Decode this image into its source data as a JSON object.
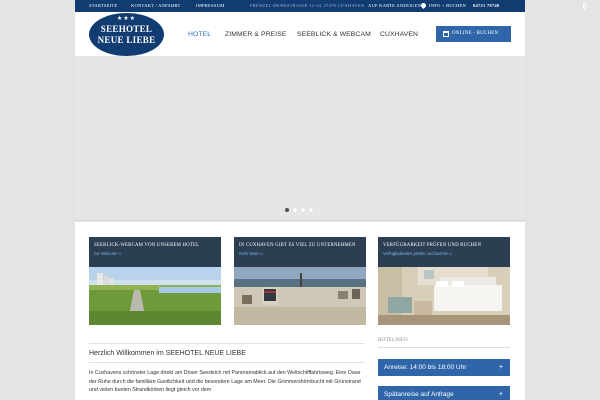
{
  "topbar": {
    "start": "STARTSEITE",
    "contact": "KONTAKT / ANFAHRT",
    "impressum": "IMPRESSUM",
    "address": "FRENZEL-DENKSTRASSE 12-14, 27476 CUXHAVEN",
    "map_link": "AUF KARTE ANZEIGEN",
    "info": "INFO + BUCHEN",
    "phone": "04721 79740"
  },
  "logo": {
    "stars": "★★★",
    "line1": "SEEHOTEL",
    "line2": "NEUE LIEBE"
  },
  "nav": {
    "items": [
      "HOTEL",
      "ZIMMER & PREISE",
      "SEEBLICK & WEBCAM",
      "CUXHAVEN"
    ],
    "book_label": "ONLINE - BUCHEN"
  },
  "slider": {
    "active_index": 0
  },
  "teasers": [
    {
      "title": "SEEBLICK-WEBCAM VON UNSEREM HOTEL",
      "link": "zur Webcam »"
    },
    {
      "title": "IN CUXHAVEN GIBT ES VIEL ZU UNTERNEHMEN",
      "link": "mehr lesen »"
    },
    {
      "title": "VERFÜGBARKEIT PRÜFEN UND BUCHEN",
      "link": "Verfügbarkeiten prüfen und buchen »"
    }
  ],
  "welcome": {
    "heading": "Herzlich Willkommen im SEEHOTEL NEUE LIEBE",
    "text": "In Cuxhavens schönster Lage direkt am Döser Seedeich mit Panoramablick auf den Weltschifffahrtsweg. Eine Oase der Ruhe durch die familiäre Gastlichkeit und die besondere Lage am Meer. Die Grimmershörnbucht mit Grünstrand und vielen bunten Strandkörben liegt gleich vor dem"
  },
  "sidebar": {
    "title": "HOTELINFO",
    "items": [
      "Anreise: 14:00 bis 18:00 Uhr",
      "Spätanreise auf Anfrage"
    ]
  },
  "colors": {
    "navy": "#113c72",
    "button_blue": "#2e66a9",
    "active_nav": "#2f76c0"
  }
}
